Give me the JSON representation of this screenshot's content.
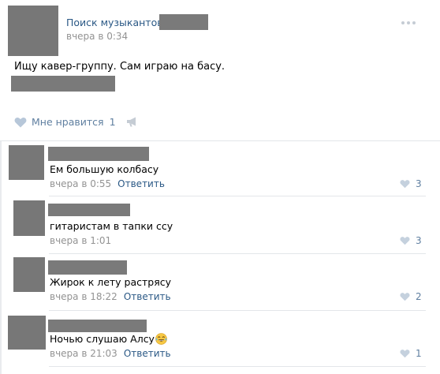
{
  "post": {
    "group_name": "Поиск музыкантов",
    "time": "вчера в 0:34",
    "text": "Ищу кавер-группу. Сам играю на басу.",
    "like_label": "Мне нравится",
    "like_count": "1"
  },
  "icons": {
    "heart": "heart-icon",
    "share": "megaphone-icon",
    "menu": "more-dots-icon",
    "emoji": "tears-of-joy-emoji"
  },
  "colors": {
    "link": "#2a5885",
    "meta": "#939393",
    "like": "#5f7fa0",
    "redaction": "#7a7a7a"
  },
  "comments": [
    {
      "text": "Ем большую колбасу",
      "time": "вчера в 0:55",
      "reply": "Ответить",
      "likes": "3"
    },
    {
      "text": "гитаристам в тапки ссу",
      "time": "вчера в 1:01",
      "reply": "",
      "likes": "3"
    },
    {
      "text": "Жирок к лету растрясу",
      "time": "вчера в 18:22",
      "reply": "Ответить",
      "likes": "2"
    },
    {
      "text": "Ночью слушаю Алсу",
      "time": "вчера в 21:03",
      "reply": "Ответить",
      "likes": "1"
    }
  ]
}
